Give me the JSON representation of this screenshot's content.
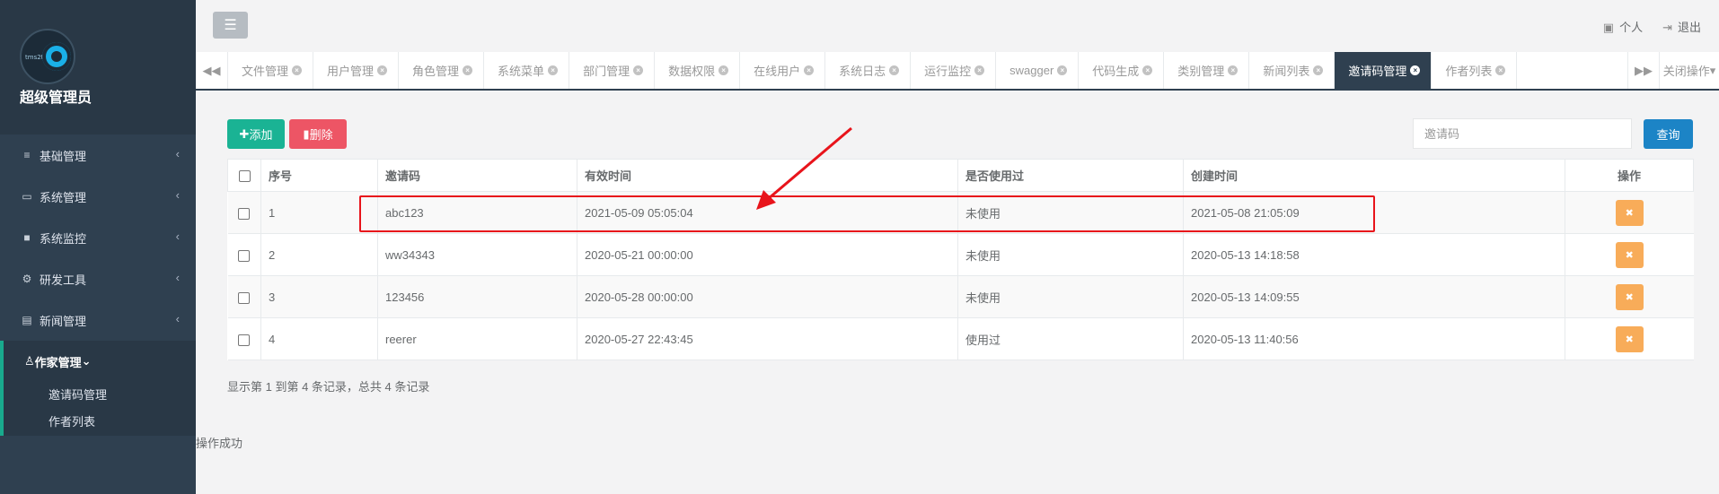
{
  "sidebar": {
    "avatar_text": "tms2tb",
    "user_name": "超级管理员",
    "menu": [
      {
        "icon": "bars-icon",
        "label": "基础管理"
      },
      {
        "icon": "desktop-icon",
        "label": "系统管理"
      },
      {
        "icon": "video-icon",
        "label": "系统监控"
      },
      {
        "icon": "cog-icon",
        "label": "研发工具"
      },
      {
        "icon": "newspaper-icon",
        "label": "新闻管理"
      }
    ],
    "active_menu": {
      "icon": "user-icon",
      "label": "作家管理",
      "children": [
        "邀请码管理",
        "作者列表"
      ]
    }
  },
  "topbar": {
    "personal_label": "个人",
    "logout_label": "退出"
  },
  "tabs": {
    "items": [
      "文件管理",
      "用户管理",
      "角色管理",
      "系统菜单",
      "部门管理",
      "数据权限",
      "在线用户",
      "系统日志",
      "运行监控",
      "swagger",
      "代码生成",
      "类别管理",
      "新闻列表",
      "邀请码管理",
      "作者列表"
    ],
    "active": "邀请码管理",
    "close_ops_label": "关闭操作"
  },
  "toolbar": {
    "add_label": "添加",
    "delete_label": "删除",
    "search_placeholder": "邀请码",
    "query_label": "查询"
  },
  "table": {
    "columns": [
      "序号",
      "邀请码",
      "有效时间",
      "是否使用过",
      "创建时间",
      "操作"
    ],
    "rows": [
      {
        "index": "1",
        "code": "abc123",
        "valid_time": "2021-05-09 05:05:04",
        "used": "未使用",
        "created": "2021-05-08 21:05:09"
      },
      {
        "index": "2",
        "code": "ww34343",
        "valid_time": "2020-05-21 00:00:00",
        "used": "未使用",
        "created": "2020-05-13 14:18:58"
      },
      {
        "index": "3",
        "code": "123456",
        "valid_time": "2020-05-28 00:00:00",
        "used": "未使用",
        "created": "2020-05-13 14:09:55"
      },
      {
        "index": "4",
        "code": "reerer",
        "valid_time": "2020-05-27 22:43:45",
        "used": "使用过",
        "created": "2020-05-13 11:40:56"
      }
    ]
  },
  "pagination_text": "显示第 1 到第 4 条记录，总共 4 条记录",
  "toast_text": "操作成功",
  "colors": {
    "sidebar_bg": "#2f4050",
    "accent_green": "#1ab394",
    "danger_red": "#ed5565",
    "primary_blue": "#1c84c6",
    "warning_orange": "#f8ac59",
    "annotation_red": "#e8141b"
  }
}
